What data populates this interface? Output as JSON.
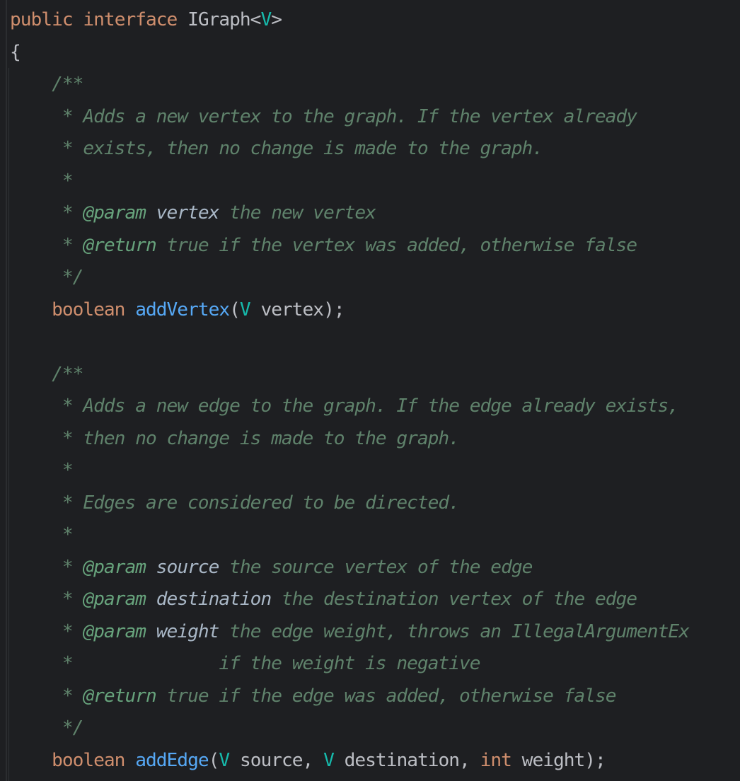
{
  "editor": {
    "language": "Java",
    "colors": {
      "background": "#1e1f22",
      "keyword": "#cf8e6d",
      "type_param": "#16baac",
      "method": "#56a8f5",
      "identifier": "#bcbec4",
      "doc_comment": "#5f826b",
      "doc_tag": "#67a37c"
    },
    "lines": [
      {
        "tokens": [
          [
            "kw",
            "public"
          ],
          [
            "id",
            " "
          ],
          [
            "kw",
            "interface"
          ],
          [
            "id",
            " IGraph<"
          ],
          [
            "tp",
            "V"
          ],
          [
            "id",
            ">"
          ]
        ]
      },
      {
        "tokens": [
          [
            "id",
            "{"
          ]
        ]
      },
      {
        "tokens": [
          [
            "id",
            "    "
          ],
          [
            "doc",
            "/**"
          ]
        ]
      },
      {
        "tokens": [
          [
            "id",
            "     "
          ],
          [
            "doc",
            "* Adds a new vertex to the graph. If the vertex already"
          ]
        ]
      },
      {
        "tokens": [
          [
            "id",
            "     "
          ],
          [
            "doc",
            "* exists, then no change is made to the graph."
          ]
        ]
      },
      {
        "tokens": [
          [
            "id",
            "     "
          ],
          [
            "doc",
            "*"
          ]
        ]
      },
      {
        "tokens": [
          [
            "id",
            "     "
          ],
          [
            "doc",
            "* "
          ],
          [
            "tag",
            "@param"
          ],
          [
            "doc",
            " "
          ],
          [
            "pn",
            "vertex"
          ],
          [
            "doc",
            " the new vertex"
          ]
        ]
      },
      {
        "tokens": [
          [
            "id",
            "     "
          ],
          [
            "doc",
            "* "
          ],
          [
            "tag",
            "@return"
          ],
          [
            "doc",
            " true if the vertex was added, otherwise false"
          ]
        ]
      },
      {
        "tokens": [
          [
            "id",
            "     "
          ],
          [
            "doc",
            "*/"
          ]
        ]
      },
      {
        "tokens": [
          [
            "id",
            "    "
          ],
          [
            "kw",
            "boolean"
          ],
          [
            "id",
            " "
          ],
          [
            "fn",
            "addVertex"
          ],
          [
            "id",
            "("
          ],
          [
            "tp",
            "V"
          ],
          [
            "id",
            " vertex);"
          ]
        ]
      },
      {
        "tokens": [
          [
            "id",
            " "
          ]
        ]
      },
      {
        "tokens": [
          [
            "id",
            "    "
          ],
          [
            "doc",
            "/**"
          ]
        ]
      },
      {
        "tokens": [
          [
            "id",
            "     "
          ],
          [
            "doc",
            "* Adds a new edge to the graph. If the edge already exists,"
          ]
        ]
      },
      {
        "tokens": [
          [
            "id",
            "     "
          ],
          [
            "doc",
            "* then no change is made to the graph."
          ]
        ]
      },
      {
        "tokens": [
          [
            "id",
            "     "
          ],
          [
            "doc",
            "*"
          ]
        ]
      },
      {
        "tokens": [
          [
            "id",
            "     "
          ],
          [
            "doc",
            "* Edges are considered to be directed."
          ]
        ]
      },
      {
        "tokens": [
          [
            "id",
            "     "
          ],
          [
            "doc",
            "*"
          ]
        ]
      },
      {
        "tokens": [
          [
            "id",
            "     "
          ],
          [
            "doc",
            "* "
          ],
          [
            "tag",
            "@param"
          ],
          [
            "doc",
            " "
          ],
          [
            "pn",
            "source"
          ],
          [
            "doc",
            " the source vertex of the edge"
          ]
        ]
      },
      {
        "tokens": [
          [
            "id",
            "     "
          ],
          [
            "doc",
            "* "
          ],
          [
            "tag",
            "@param"
          ],
          [
            "doc",
            " "
          ],
          [
            "pn",
            "destination"
          ],
          [
            "doc",
            " the destination vertex of the edge"
          ]
        ]
      },
      {
        "tokens": [
          [
            "id",
            "     "
          ],
          [
            "doc",
            "* "
          ],
          [
            "tag",
            "@param"
          ],
          [
            "doc",
            " "
          ],
          [
            "pn",
            "weight"
          ],
          [
            "doc",
            " the edge weight, throws an IllegalArgumentEx"
          ]
        ]
      },
      {
        "tokens": [
          [
            "id",
            "     "
          ],
          [
            "doc",
            "*              if the weight is negative"
          ]
        ]
      },
      {
        "tokens": [
          [
            "id",
            "     "
          ],
          [
            "doc",
            "* "
          ],
          [
            "tag",
            "@return"
          ],
          [
            "doc",
            " true if the edge was added, otherwise false"
          ]
        ]
      },
      {
        "tokens": [
          [
            "id",
            "     "
          ],
          [
            "doc",
            "*/"
          ]
        ]
      },
      {
        "tokens": [
          [
            "id",
            "    "
          ],
          [
            "kw",
            "boolean"
          ],
          [
            "id",
            " "
          ],
          [
            "fn",
            "addEdge"
          ],
          [
            "id",
            "("
          ],
          [
            "tp",
            "V"
          ],
          [
            "id",
            " source, "
          ],
          [
            "tp",
            "V"
          ],
          [
            "id",
            " destination, "
          ],
          [
            "kw",
            "int"
          ],
          [
            "id",
            " weight);"
          ]
        ]
      }
    ]
  }
}
